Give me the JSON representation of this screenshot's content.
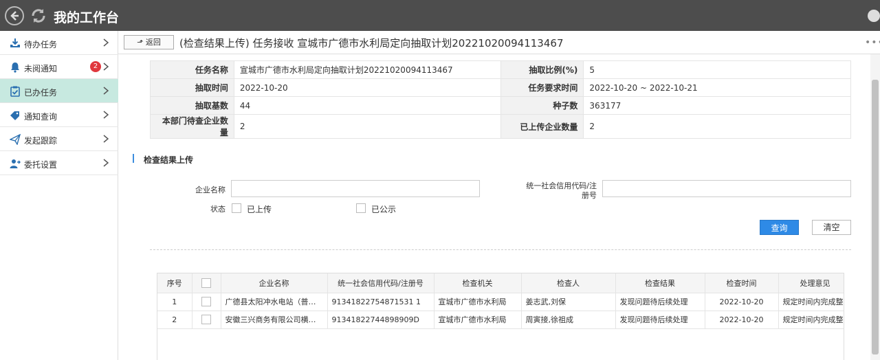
{
  "app": {
    "title": "我的工作台"
  },
  "sidebar": {
    "items": [
      {
        "label": "待办任务",
        "icon": "download-tray-icon"
      },
      {
        "label": "未阅通知",
        "icon": "bell-icon",
        "badge": "2"
      },
      {
        "label": "已办任务",
        "icon": "clipboard-check-icon",
        "active": true
      },
      {
        "label": "通知查询",
        "icon": "tag-icon"
      },
      {
        "label": "发起跟踪",
        "icon": "paper-plane-icon"
      },
      {
        "label": "委托设置",
        "icon": "user-delegate-icon"
      }
    ]
  },
  "header": {
    "back_label": "返回",
    "page_title": "(检查结果上传) 任务接收 宣城市广德市水利局定向抽取计划20221020094113467",
    "more": "•••"
  },
  "info": {
    "task_name_label": "任务名称",
    "task_name": "宣城市广德市水利局定向抽取计划20221020094113467",
    "ratio_label": "抽取比例(%)",
    "ratio": "5",
    "extract_time_label": "抽取时间",
    "extract_time": "2022-10-20",
    "req_time_label": "任务要求时间",
    "req_time": "2022-10-20 ~ 2022-10-21",
    "base_label": "抽取基数",
    "base": "44",
    "seed_label": "种子数",
    "seed": "363177",
    "pending_label": "本部门待查企业数量",
    "pending": "2",
    "uploaded_label": "已上传企业数量",
    "uploaded": "2"
  },
  "section": {
    "title": "检查结果上传"
  },
  "form": {
    "company_label": "企业名称",
    "company_value": "",
    "credit_label": "统一社会信用代码/注册号",
    "credit_value": "",
    "status_label": "状态",
    "opt_uploaded": "已上传",
    "opt_published": "已公示",
    "query_label": "查询",
    "clear_label": "清空"
  },
  "grid": {
    "headers": [
      "序号",
      "",
      "企业名称",
      "统一社会信用代码/注册号",
      "检查机关",
      "检查人",
      "检查结果",
      "检查时间",
      "处理意见"
    ],
    "rows": [
      [
        "1",
        "",
        "广德县太阳冲水电站（普…",
        "91341822754871531 1",
        "宣城市广德市水利局",
        "姜志武,刘保",
        "发现问题待后续处理",
        "2022-10-20",
        "规定时间内完成整改"
      ],
      [
        "2",
        "",
        "安徽三兴商务有限公司横…",
        "91341822744898909D",
        "宣城市广德市水利局",
        "周寅接,徐祖成",
        "发现问题待后续处理",
        "2022-10-20",
        "规定时间内完成整改"
      ]
    ]
  },
  "colors": {
    "topbar": "#4d4d4d",
    "active": "#c7e9e0",
    "accent": "#2e8ae6",
    "badge": "#e0383e"
  }
}
